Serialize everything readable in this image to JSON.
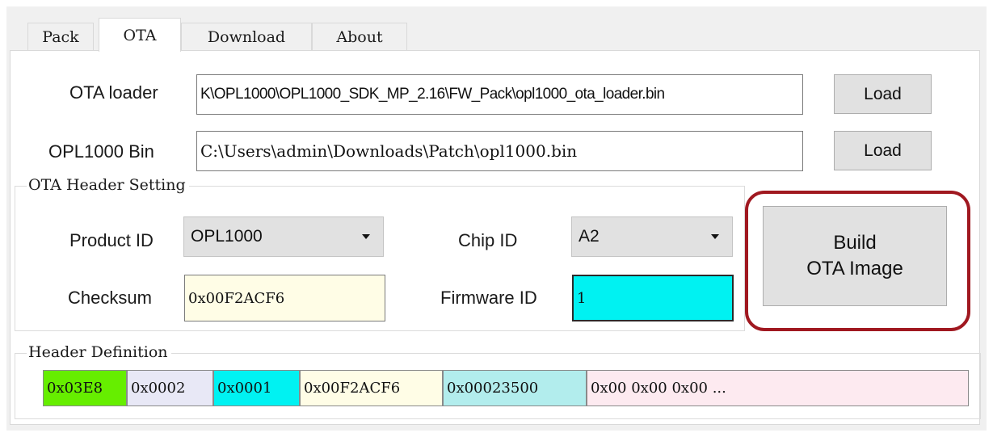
{
  "tabs": [
    {
      "label": "Pack"
    },
    {
      "label": "OTA"
    },
    {
      "label": "Download"
    },
    {
      "label": "About"
    }
  ],
  "active_tab": "OTA",
  "ota_loader": {
    "label": "OTA loader",
    "path": "K\\OPL1000\\OPL1000_SDK_MP_2.16\\FW_Pack\\opl1000_ota_loader.bin",
    "button": "Load"
  },
  "opl_bin": {
    "label": "OPL1000 Bin",
    "path": "C:\\Users\\admin\\Downloads\\Patch\\opl1000.bin",
    "button": "Load"
  },
  "header_setting": {
    "title": "OTA Header Setting",
    "product_id_label": "Product ID",
    "product_id_value": "OPL1000",
    "chip_id_label": "Chip ID",
    "chip_id_value": "A2",
    "checksum_label": "Checksum",
    "checksum_value": "0x00F2ACF6",
    "firmware_id_label": "Firmware ID",
    "firmware_id_value": "1"
  },
  "build_button": {
    "line1": "Build",
    "line2": "OTA Image"
  },
  "header_definition": {
    "title": "Header Definition",
    "segments": [
      {
        "value": "0x03E8",
        "color": "#66ee00"
      },
      {
        "value": "0x0002",
        "color": "#e8e8f6"
      },
      {
        "value": "0x0001",
        "color": "#00f2f2"
      },
      {
        "value": "0x00F2ACF6",
        "color": "#fffde6"
      },
      {
        "value": "0x00023500",
        "color": "#b2eded"
      },
      {
        "value": "0x00 0x00 0x00 ...",
        "color": "#fdeaf0"
      }
    ]
  },
  "colors": {
    "checksum_bg": "#fffde6",
    "firmware_id_bg": "#00f2f2",
    "highlight_ring": "#a01820"
  }
}
